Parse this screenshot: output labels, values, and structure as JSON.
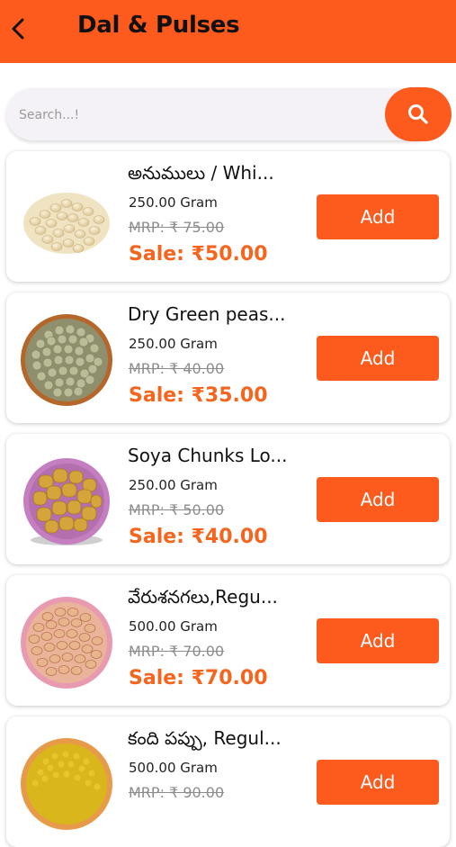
{
  "header": {
    "title": "Dal & Pulses",
    "back_icon": "chevron-left-icon"
  },
  "search": {
    "placeholder": "Search...!",
    "value": "",
    "icon": "search-icon"
  },
  "colors": {
    "accent": "#fd5a1e",
    "sale_price": "#f5651e",
    "search_bg": "#f5f2f7"
  },
  "products": [
    {
      "name": "అనుములు / Whi...",
      "quantity": "250.00 Gram",
      "mrp": "MRP: ₹ 75.00",
      "sale": "Sale: ₹50.00",
      "add_label": "Add",
      "image": "white-beans-pile-image"
    },
    {
      "name": "Dry Green peas...",
      "quantity": "250.00 Gram",
      "mrp": "MRP: ₹ 40.00",
      "sale": "Sale: ₹35.00",
      "add_label": "Add",
      "image": "green-peas-bowl-image"
    },
    {
      "name": "Soya Chunks Lo...",
      "quantity": "250.00 Gram",
      "mrp": "MRP: ₹ 50.00",
      "sale": "Sale: ₹40.00",
      "add_label": "Add",
      "image": "soya-chunks-bowl-image"
    },
    {
      "name": "వేరుశనగలు,Regu...",
      "quantity": "500.00 Gram",
      "mrp": "MRP: ₹ 70.00",
      "sale": "Sale: ₹70.00",
      "add_label": "Add",
      "image": "peanuts-plate-image"
    },
    {
      "name": "కంది పప్పు, Regul...",
      "quantity": "500.00 Gram",
      "mrp": "MRP: ₹ 90.00",
      "sale": "",
      "add_label": "Add",
      "image": "toor-dal-plate-image"
    }
  ]
}
